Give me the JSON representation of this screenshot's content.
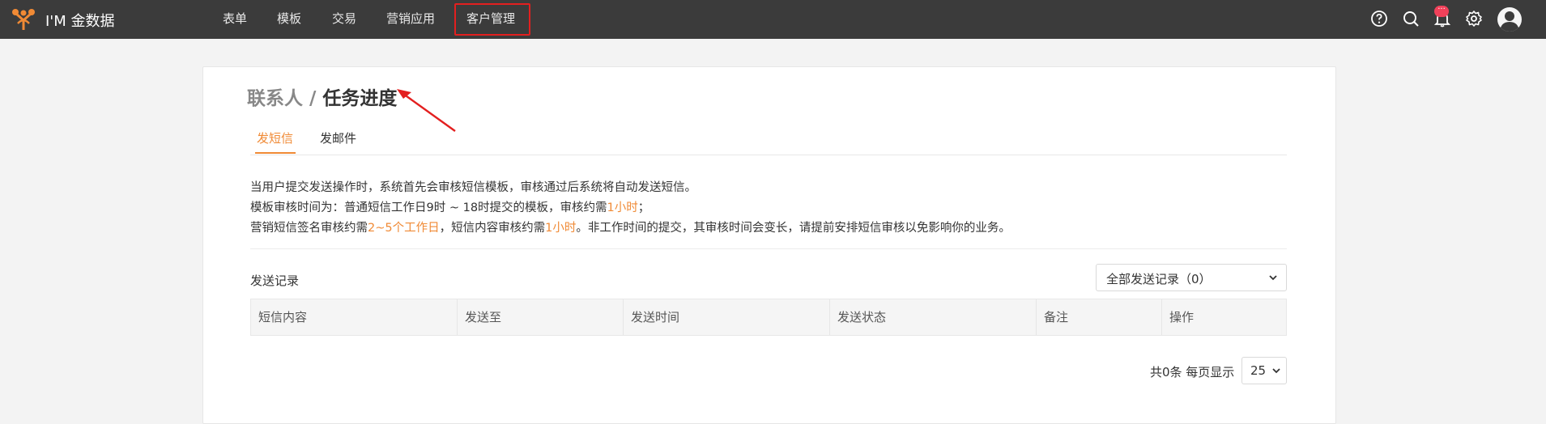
{
  "app": {
    "brand": "I'M 金数据"
  },
  "nav": {
    "items": [
      {
        "label": "表单"
      },
      {
        "label": "模板"
      },
      {
        "label": "交易"
      },
      {
        "label": "营销应用"
      },
      {
        "label": "客户管理"
      }
    ],
    "notification_badge": "···",
    "icons": [
      "help-icon",
      "search-icon",
      "bell-icon",
      "gear-icon",
      "avatar"
    ]
  },
  "page": {
    "breadcrumb": "联系人",
    "separator": " / ",
    "title": "任务进度"
  },
  "tabs": [
    {
      "label": "发短信",
      "active": true
    },
    {
      "label": "发邮件",
      "active": false
    }
  ],
  "notice": {
    "line1": "当用户提交发送操作时，系统首先会审核短信模板，审核通过后系统将自动发送短信。",
    "line2_prefix": "模板审核时间为：普通短信工作日9时 ~ 18时提交的模板，审核约需",
    "line2_highlight": "1小时",
    "line2_suffix": "；",
    "line3_prefix": "营销短信签名审核约需",
    "line3_highlight1": "2~5个工作日",
    "line3_mid": "，短信内容审核约需",
    "line3_highlight2": "1小时",
    "line3_suffix": "。非工作时间的提交，其审核时间会变长，请提前安排短信审核以免影响你的业务。"
  },
  "records": {
    "label": "发送记录",
    "filter_selected": "全部发送记录（0）",
    "columns": [
      "短信内容",
      "发送至",
      "发送时间",
      "发送状态",
      "备注",
      "操作"
    ],
    "rows": []
  },
  "pagination": {
    "summary": "共0条 每页显示",
    "page_size": "25"
  },
  "colors": {
    "topbar": "#3b3b3b",
    "accent": "#f08a35",
    "annotation_red": "#e31f1f"
  }
}
